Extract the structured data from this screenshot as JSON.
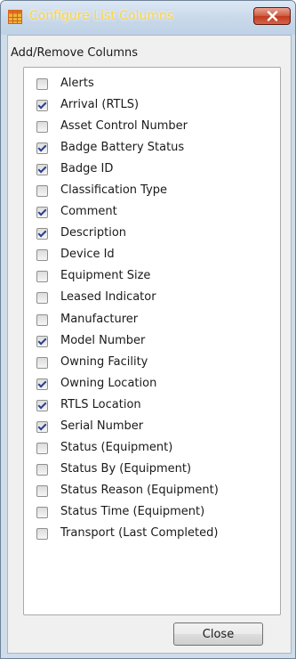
{
  "window": {
    "title": "Configure List Columns"
  },
  "group": {
    "label": "Add/Remove Columns"
  },
  "columns": [
    {
      "label": "Alerts",
      "checked": false
    },
    {
      "label": "Arrival (RTLS)",
      "checked": true
    },
    {
      "label": "Asset Control Number",
      "checked": false
    },
    {
      "label": "Badge Battery Status",
      "checked": true
    },
    {
      "label": "Badge ID",
      "checked": true
    },
    {
      "label": "Classification Type",
      "checked": false
    },
    {
      "label": "Comment",
      "checked": true
    },
    {
      "label": "Description",
      "checked": true
    },
    {
      "label": "Device Id",
      "checked": false
    },
    {
      "label": "Equipment Size",
      "checked": false
    },
    {
      "label": "Leased Indicator",
      "checked": false
    },
    {
      "label": "Manufacturer",
      "checked": false
    },
    {
      "label": "Model Number",
      "checked": true
    },
    {
      "label": "Owning Facility",
      "checked": false
    },
    {
      "label": "Owning Location",
      "checked": true
    },
    {
      "label": "RTLS Location",
      "checked": true
    },
    {
      "label": "Serial Number",
      "checked": true
    },
    {
      "label": "Status (Equipment)",
      "checked": false
    },
    {
      "label": "Status By (Equipment)",
      "checked": false
    },
    {
      "label": "Status Reason (Equipment)",
      "checked": false
    },
    {
      "label": "Status Time (Equipment)",
      "checked": false
    },
    {
      "label": "Transport (Last Completed)",
      "checked": false
    }
  ],
  "footer": {
    "close_label": "Close"
  },
  "icons": {
    "app": "grid-table-icon",
    "window_close": "close-icon"
  },
  "colors": {
    "title_text": "#ffd43a",
    "window_frame": "#cfdcea",
    "close_red": "#c23a20",
    "check_mark": "#2c3f8f"
  }
}
